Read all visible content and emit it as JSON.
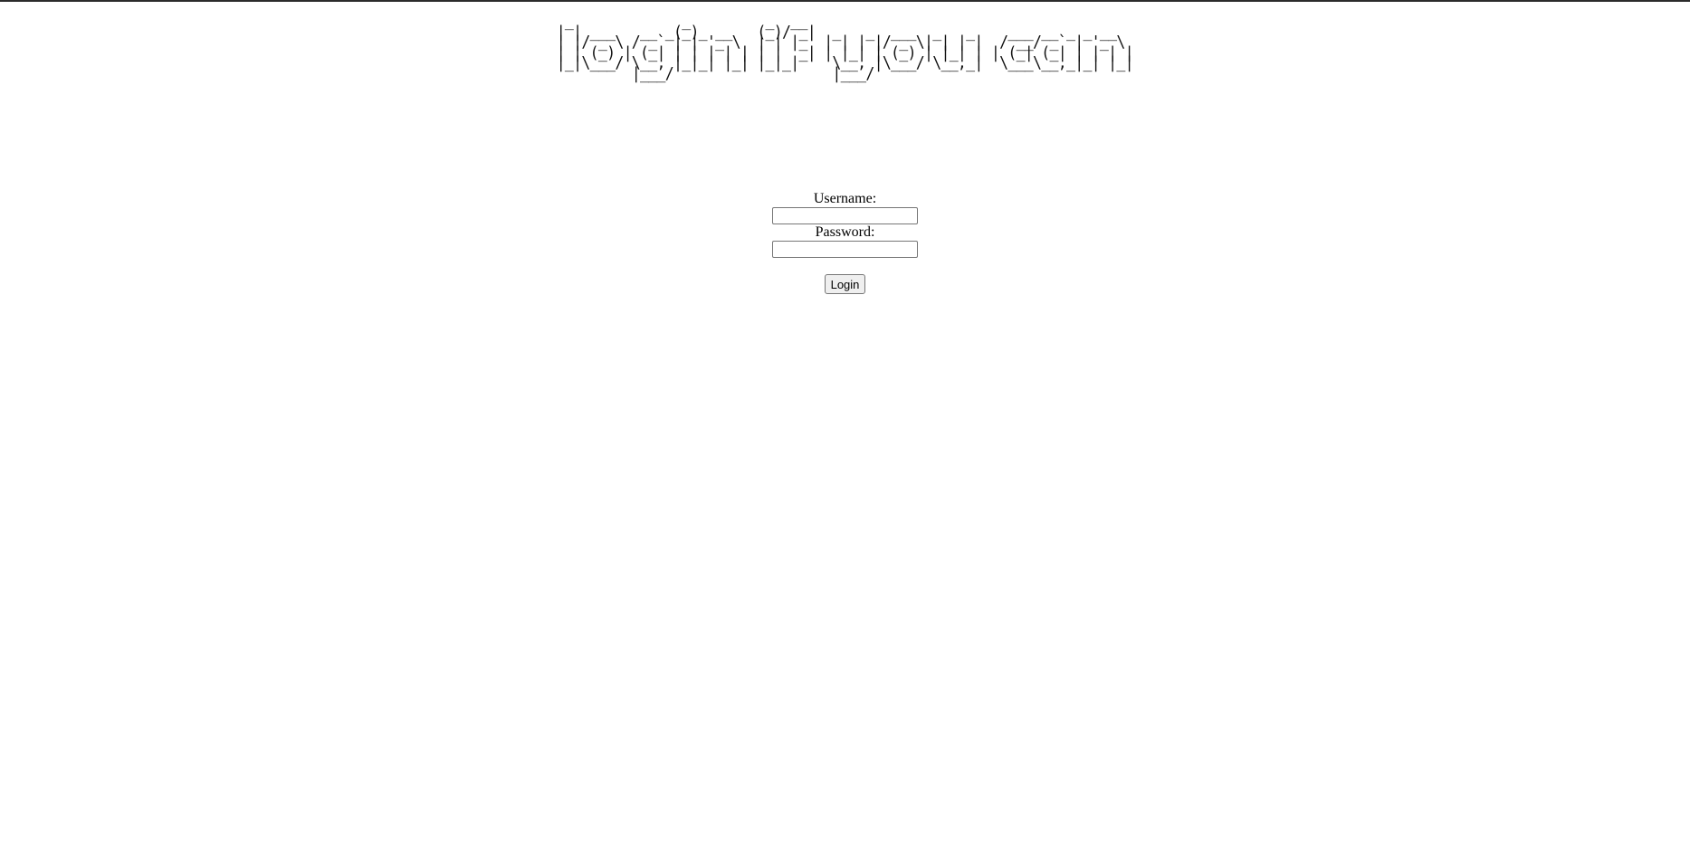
{
  "page": {
    "banner_ascii": " _             _         _  __                                      \n| | ___   __ _(_)_ __   (_)/ _|  _   _  ___  _   _    ___ __ _ _ __  \n| |/ _ \\ / _` | | '_ \\  | | |_  | | | |/ _ \\| | | |  / __/ _` | '_ \\ \n| | (_) | (_| | | | | | | |  _| | |_| | (_) | |_| | | (_| (_| | | | |\n|_|\\___/ \\__, |_|_| |_| |_|_|    \\__, |\\___/ \\__,_|  \\___\\__,_|_| |_|\n         |___/                   |___/                               "
  },
  "login_form": {
    "username_label": "Username:",
    "username_value": "",
    "password_label": "Password:",
    "password_value": "",
    "login_button_label": "Login"
  },
  "colors": {
    "top_border": "#2b2b2b",
    "background": "#ffffff",
    "text": "#000000"
  }
}
